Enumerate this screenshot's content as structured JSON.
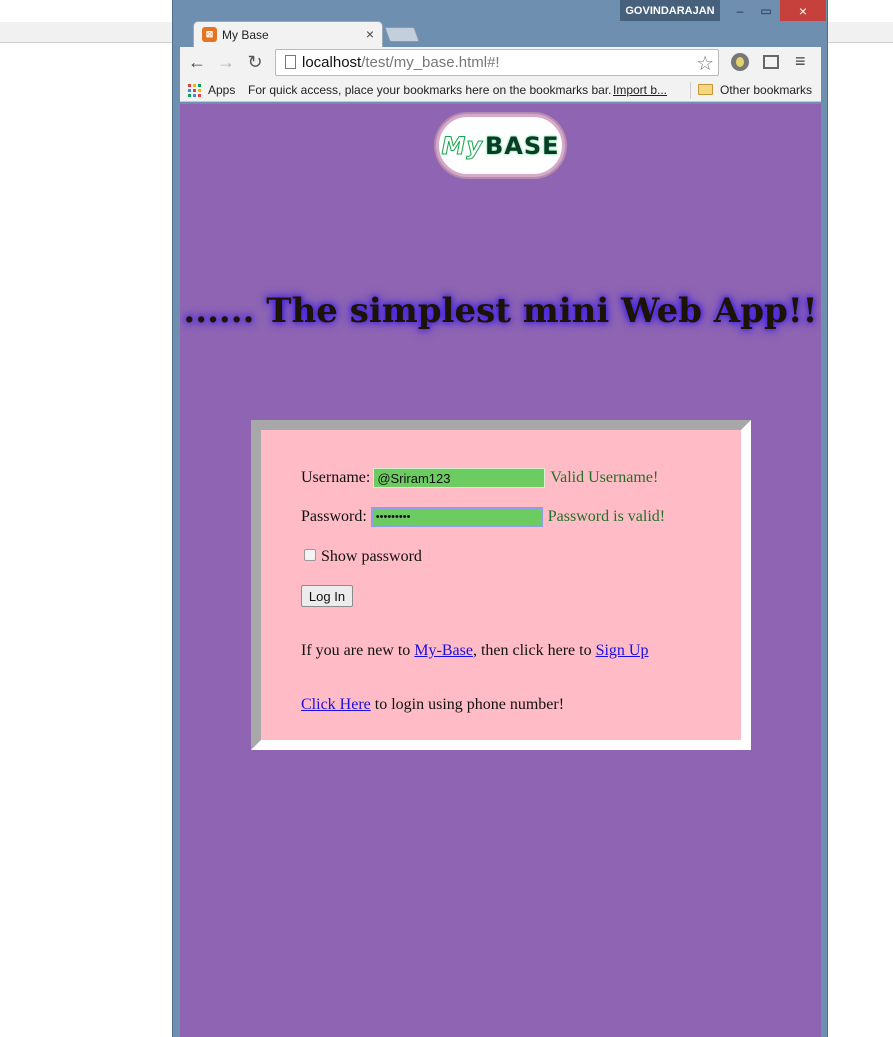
{
  "window": {
    "user": "GOVINDARAJAN",
    "minimize_glyph": "–",
    "maximize_glyph": "▭",
    "close_glyph": "×"
  },
  "tab": {
    "title": "My Base",
    "close_glyph": "×"
  },
  "toolbar": {
    "url_host": "localhost",
    "url_path": "/test/my_base.html#!",
    "back_glyph": "←",
    "forward_glyph": "→",
    "reload_glyph": "↻",
    "star_glyph": "☆",
    "menu_glyph": "≡"
  },
  "bookmarks": {
    "apps": "Apps",
    "hint": "For quick access, place your bookmarks here on the bookmarks bar.",
    "import": "Import b...",
    "other": "Other bookmarks"
  },
  "page": {
    "logo_my": "My",
    "logo_base": "BASE",
    "tagline": "...... The simplest mini Web App!!",
    "login": {
      "username_label": "Username:",
      "username_value": "@Sriram123",
      "username_status": "Valid Username!",
      "password_label": "Password:",
      "password_value": "•••••••••",
      "password_status": "Password is valid!",
      "show_password": "Show password",
      "login_button": "Log In",
      "new_prefix": "If you are new to ",
      "new_link": "My-Base",
      "new_middle": ", then click here to ",
      "signup_link": "Sign Up",
      "phone_link": "Click Here",
      "phone_suffix": " to login using phone number!"
    }
  },
  "colors": {
    "page_bg": "#8e64b3",
    "login_bg": "#ffbcc6",
    "valid_field": "#6ccc62",
    "valid_text": "#207028",
    "link": "#1a0ee0"
  }
}
